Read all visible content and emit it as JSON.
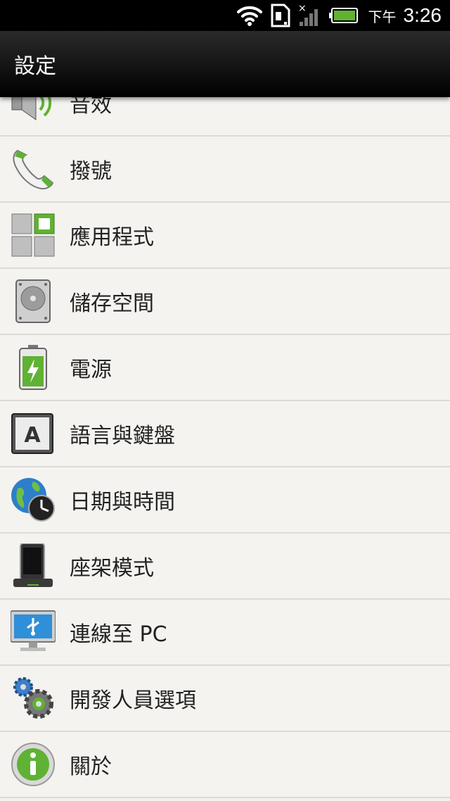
{
  "status_bar": {
    "icons": [
      "wifi-icon",
      "sim-card-icon",
      "signal-no-service-icon",
      "battery-icon"
    ],
    "time_prefix": "下午",
    "time": "3:26"
  },
  "action_bar": {
    "title": "設定"
  },
  "settings": [
    {
      "label": "音效",
      "icon": "speaker-icon"
    },
    {
      "label": "撥號",
      "icon": "phone-handset-icon"
    },
    {
      "label": "應用程式",
      "icon": "apps-grid-icon"
    },
    {
      "label": "儲存空間",
      "icon": "storage-drive-icon"
    },
    {
      "label": "電源",
      "icon": "battery-power-icon"
    },
    {
      "label": "語言與鍵盤",
      "icon": "language-keyboard-icon"
    },
    {
      "label": "日期與時間",
      "icon": "globe-clock-icon"
    },
    {
      "label": "座架模式",
      "icon": "dock-icon"
    },
    {
      "label": "連線至 PC",
      "icon": "usb-monitor-icon"
    },
    {
      "label": "開發人員選項",
      "icon": "gears-icon"
    },
    {
      "label": "關於",
      "icon": "info-icon"
    }
  ],
  "colors": {
    "accent_green": "#5fb233",
    "list_background": "#f4f3f0",
    "divider": "#dcdad6"
  }
}
